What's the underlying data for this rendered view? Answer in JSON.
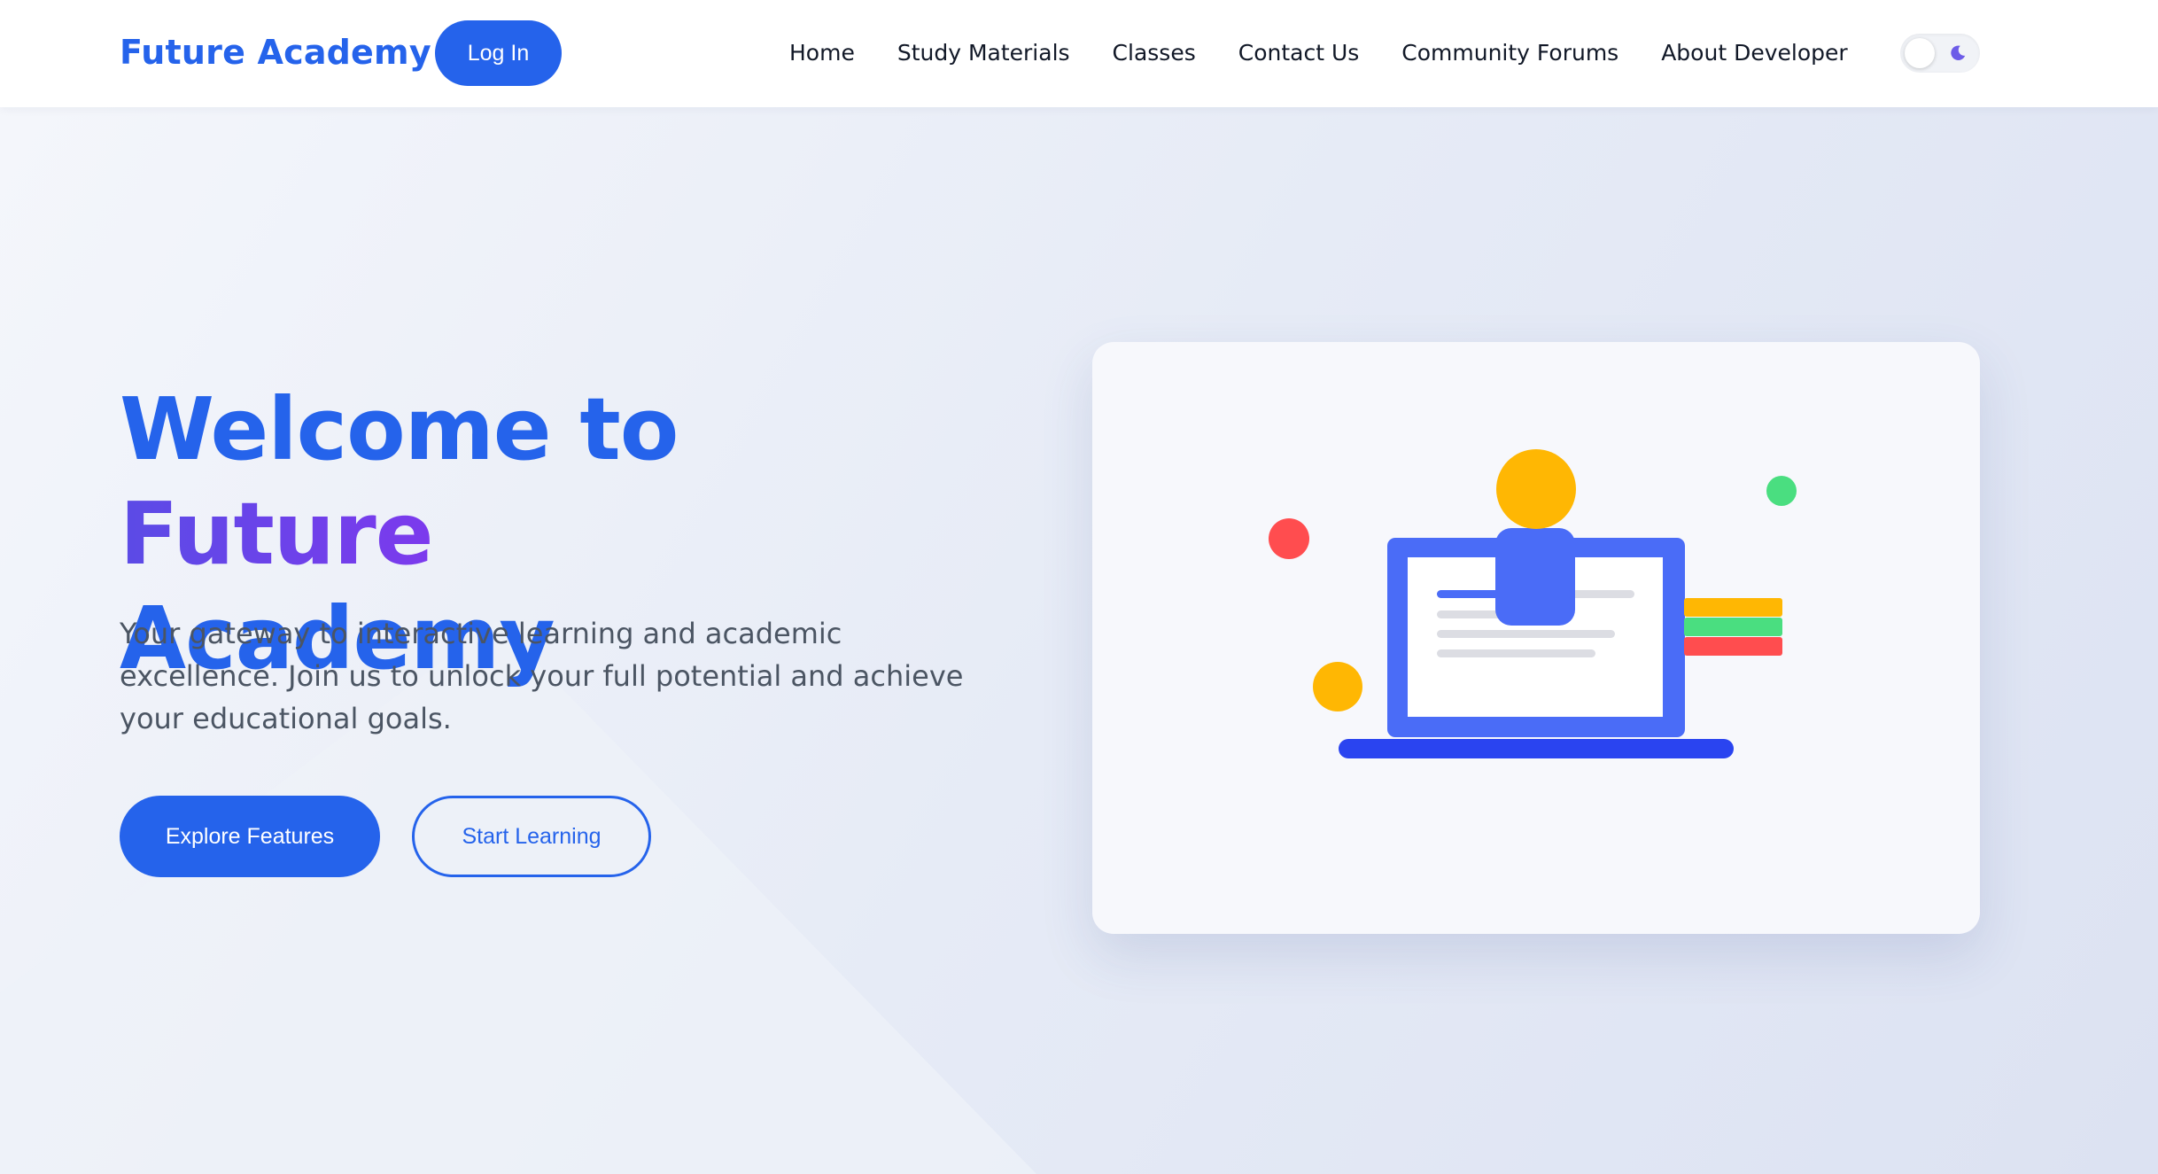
{
  "brand": "Future Academy",
  "login_label": "Log In",
  "nav": {
    "items": [
      {
        "label": "Home"
      },
      {
        "label": "Study Materials"
      },
      {
        "label": "Classes"
      },
      {
        "label": "Contact Us"
      },
      {
        "label": "Community Forums"
      },
      {
        "label": "About Developer"
      }
    ]
  },
  "theme_toggle": {
    "icon": "moon-icon",
    "state": "light"
  },
  "hero": {
    "title_part1": "Welcome to ",
    "title_part2": "Future",
    "title_part3": "Academy",
    "description": "Your gateway to interactive learning and academic excellence. Join us to unlock your full potential and achieve your educational goals.",
    "primary_button": "Explore Features",
    "secondary_button": "Start Learning"
  },
  "illustration": {
    "name": "laptop-learner-illustration"
  },
  "colors": {
    "primary": "#2563eb",
    "accent_purple": "#7c3aed",
    "illus_blue": "#4a6cf7",
    "illus_yellow": "#ffb703",
    "illus_red": "#ff4d4f",
    "illus_green": "#4ade80"
  }
}
